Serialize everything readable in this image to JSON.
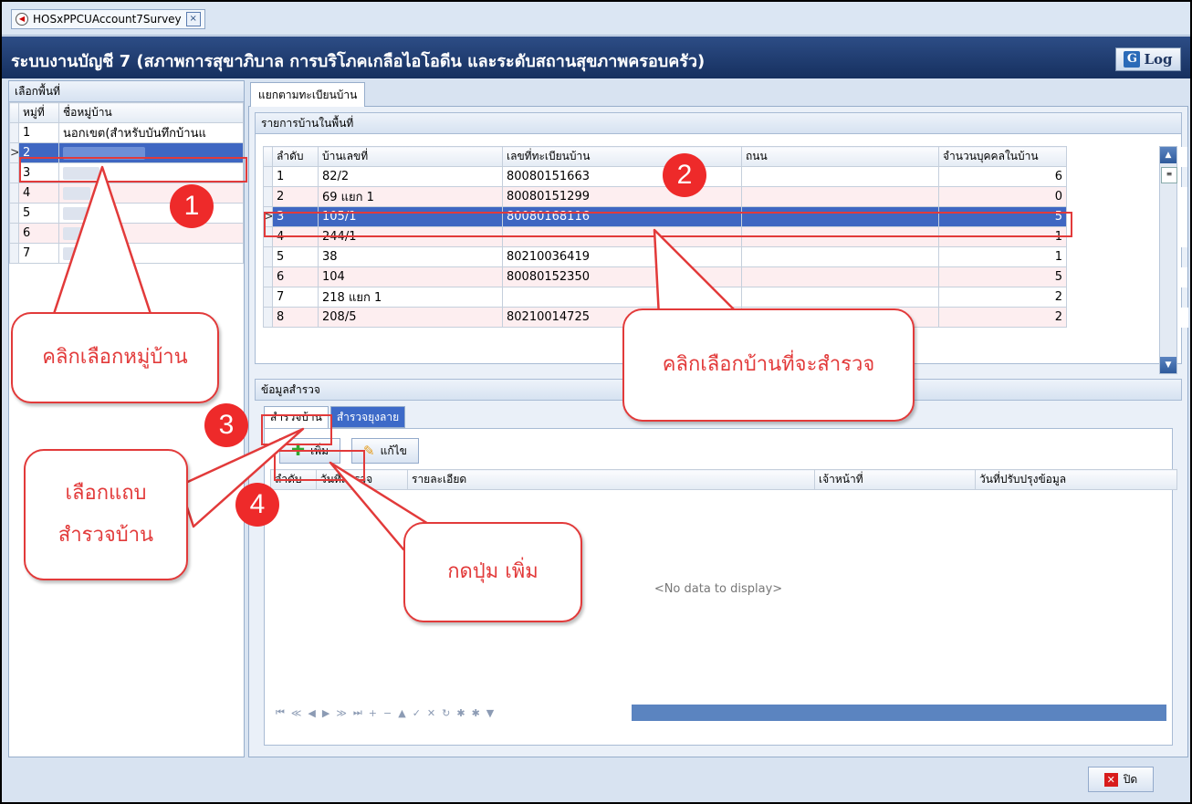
{
  "doc_tab": {
    "icon": "app-icon",
    "label": "HOSxPPCUAccount7Survey",
    "close": "×"
  },
  "title": {
    "text": "ระบบงานบัญชี 7 (สภาพการสุขาภิบาล การบริโภคเกลือไอโอดีน และระดับสถานสุขภาพครอบครัว)",
    "log_label": "Log"
  },
  "left_panel": {
    "header": "เลือกพื้นที่",
    "columns": [
      "หมู่ที่",
      "ชื่อหมู่บ้าน"
    ],
    "rows": [
      {
        "no": "1",
        "name": "นอกเขต(สำหรับบันทึกบ้านแ"
      },
      {
        "no": "2",
        "name": ""
      },
      {
        "no": "3",
        "name": ""
      },
      {
        "no": "4",
        "name": ""
      },
      {
        "no": "5",
        "name": ""
      },
      {
        "no": "6",
        "name": ""
      },
      {
        "no": "7",
        "name": ""
      }
    ]
  },
  "right_tab": "แยกตามทะเบียนบ้าน",
  "houses": {
    "header": "รายการบ้านในพื้นที่",
    "columns": [
      "ลำดับ",
      "บ้านเลขที่",
      "เลขที่ทะเบียนบ้าน",
      "ถนน",
      "จำนวนบุคคลในบ้าน"
    ],
    "rows": [
      {
        "seq": "1",
        "house_no": "82/2",
        "reg": "80080151663",
        "road": "",
        "count": "6"
      },
      {
        "seq": "2",
        "house_no": "69 แยก 1",
        "reg": "80080151299",
        "road": "",
        "count": "0"
      },
      {
        "seq": "3",
        "house_no": "105/1",
        "reg": "80080168116",
        "road": "",
        "count": "5"
      },
      {
        "seq": "4",
        "house_no": "244/1",
        "reg": "",
        "road": "",
        "count": "1"
      },
      {
        "seq": "5",
        "house_no": "38",
        "reg": "80210036419",
        "road": "",
        "count": "1"
      },
      {
        "seq": "6",
        "house_no": "104",
        "reg": "80080152350",
        "road": "",
        "count": "5"
      },
      {
        "seq": "7",
        "house_no": "218 แยก 1",
        "reg": "",
        "road": "",
        "count": "2"
      },
      {
        "seq": "8",
        "house_no": "208/5",
        "reg": "80210014725",
        "road": "",
        "count": "2"
      }
    ]
  },
  "survey": {
    "header": "ข้อมูลสำรวจ",
    "tabs": [
      "สำรวจบ้าน",
      "สำรวจยุงลาย"
    ],
    "add_label": "เพิ่ม",
    "edit_label": "แก้ไข",
    "columns": [
      "ลำดับ",
      "วันที่สำรวจ",
      "รายละเอียด",
      "เจ้าหน้าที่",
      "วันที่ปรับปรุงข้อมูล"
    ],
    "no_data": "<No data to display>",
    "nav_icons": [
      "⏮",
      "≪",
      "◀",
      "▶",
      "≫",
      "⏭",
      "+",
      "−",
      "▲",
      "✓",
      "✕",
      "↻",
      "✱",
      "✱",
      "▼"
    ]
  },
  "close_label": "ปิด",
  "annotations": {
    "markers": [
      "1",
      "2",
      "3",
      "4"
    ],
    "bubble1": "คลิกเลือกหมู่บ้าน",
    "bubble2": "คลิกเลือกบ้านที่จะสำรวจ",
    "bubble3_line1": "เลือกแถบ",
    "bubble3_line2": "สำรวจบ้าน",
    "bubble4": "กดปุ่ม เพิ่ม"
  }
}
